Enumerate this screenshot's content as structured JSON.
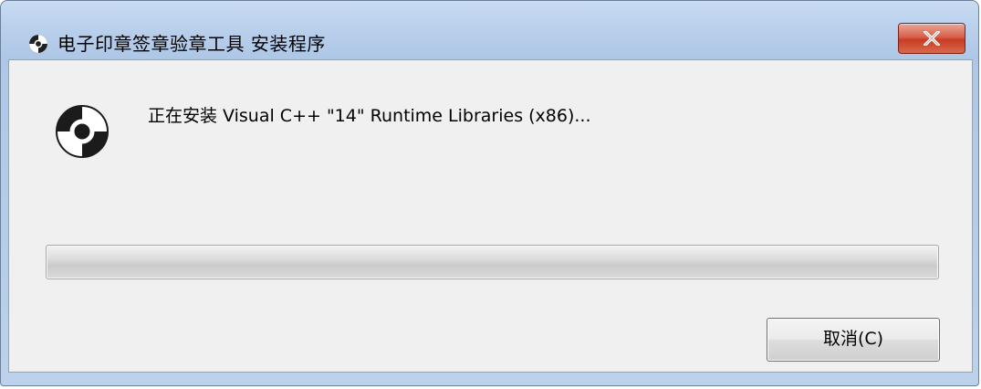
{
  "window": {
    "title": "电子印章签章验章工具 安装程序",
    "close_icon": "close-x-icon"
  },
  "main": {
    "icon": "disc-install-icon",
    "status_text": "正在安装 Visual C++ \"14\" Runtime Libraries (x86)...",
    "progress_fraction": 0
  },
  "buttons": {
    "cancel_label": "取消(C)"
  },
  "colors": {
    "close_button": "#c73c23",
    "dialog_background": "#f0f0f0",
    "progress_fill": "#22b00b"
  }
}
